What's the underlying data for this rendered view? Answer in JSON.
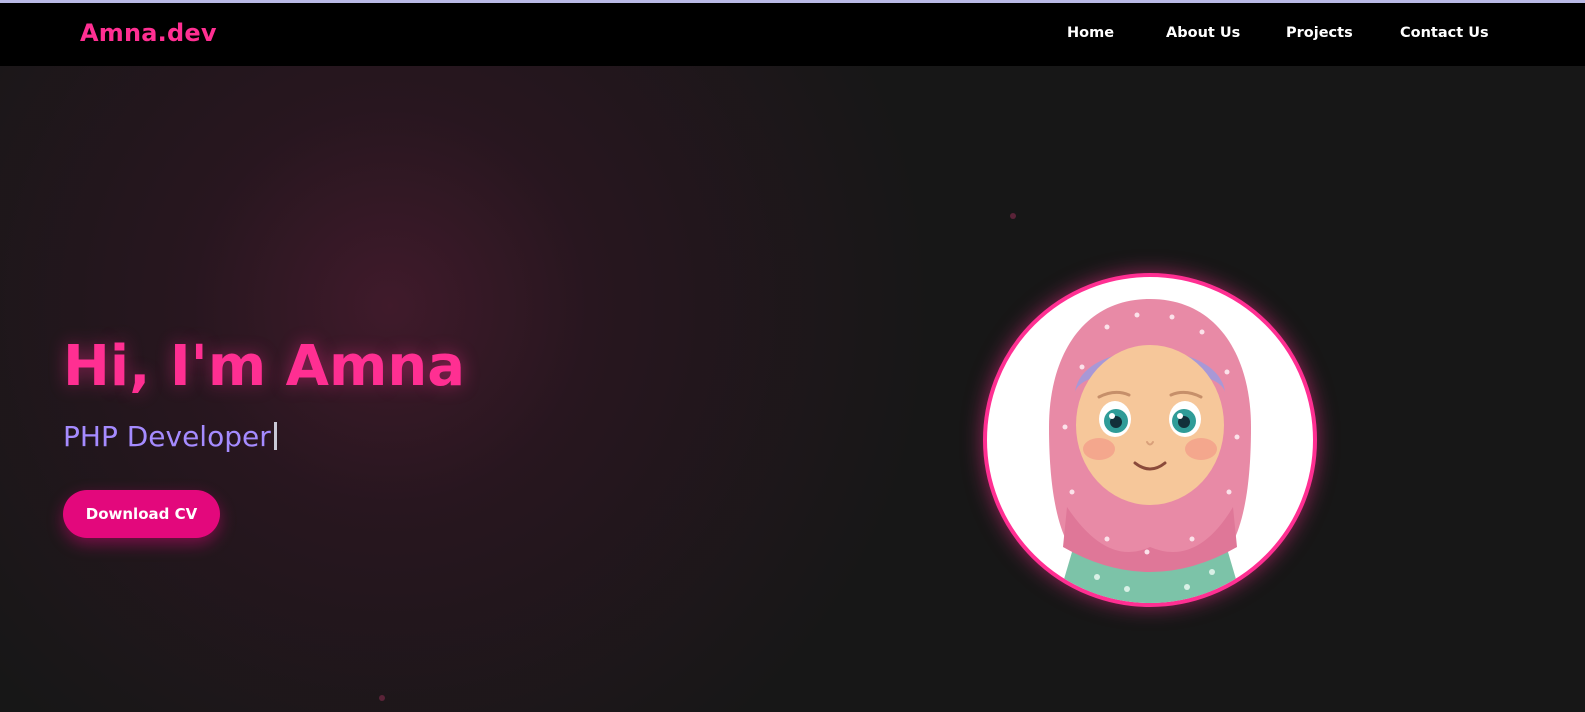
{
  "navbar": {
    "logo": "Amna.dev",
    "links": [
      {
        "label": "Home"
      },
      {
        "label": "About Us"
      },
      {
        "label": "Projects"
      },
      {
        "label": "Contact Us"
      }
    ]
  },
  "hero": {
    "title": "Hi, I'm Amna",
    "subtitle": "PHP Developer",
    "button_label": "Download CV",
    "avatar_icon": "girl-in-hijab-illustration"
  },
  "colors": {
    "accent": "#ff2f92",
    "button": "#e3087c",
    "subtitle": "#a58bff",
    "background": "#171717",
    "navbar": "#000000"
  }
}
